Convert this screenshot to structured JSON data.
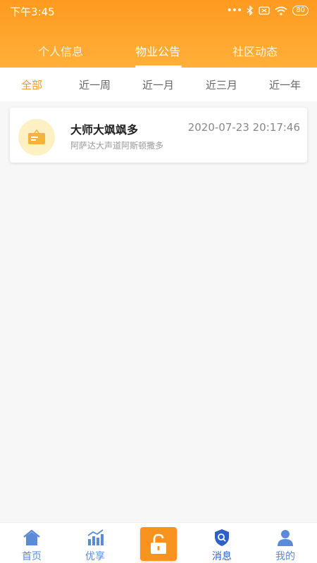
{
  "status": {
    "time": "下午3:45",
    "battery": "80"
  },
  "tabs": [
    {
      "label": "个人信息"
    },
    {
      "label": "物业公告"
    },
    {
      "label": "社区动态"
    }
  ],
  "filters": [
    {
      "label": "全部"
    },
    {
      "label": "近一周"
    },
    {
      "label": "近一月"
    },
    {
      "label": "近三月"
    },
    {
      "label": "近一年"
    }
  ],
  "notices": [
    {
      "title": "大师大飒飒多",
      "subtitle": "阿萨达大声道阿斯顿撒多",
      "time": "2020-07-23 20:17:46"
    }
  ],
  "bottom_nav": [
    {
      "label": "首页",
      "icon": "home-icon"
    },
    {
      "label": "优享",
      "icon": "chart-icon"
    },
    {
      "label": "",
      "icon": "unlock-icon"
    },
    {
      "label": "消息",
      "icon": "shield-search-icon"
    },
    {
      "label": "我的",
      "icon": "user-icon"
    }
  ],
  "colors": {
    "accent": "#f7931e",
    "nav": "#5a8ad8"
  }
}
